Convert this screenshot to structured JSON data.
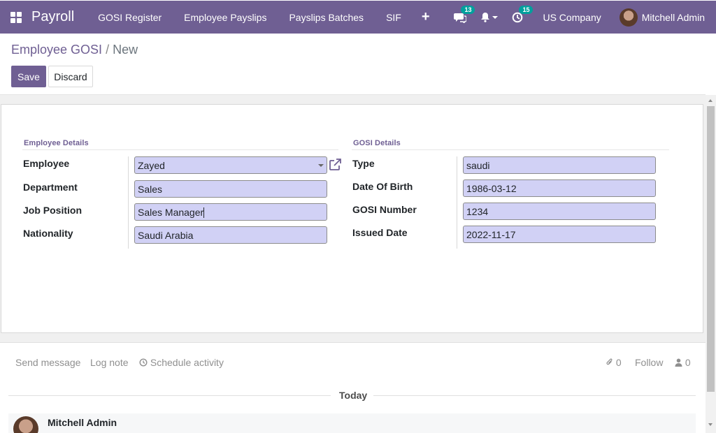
{
  "navbar": {
    "app_name": "Payroll",
    "menu": [
      "GOSI Register",
      "Employee Payslips",
      "Payslips Batches",
      "SIF"
    ],
    "plus": "+",
    "messages_badge": "13",
    "activities_badge": "15",
    "company": "US Company",
    "user": "Mitchell Admin"
  },
  "breadcrumb": {
    "parent": "Employee GOSI",
    "separator": " / ",
    "current": "New"
  },
  "buttons": {
    "save": "Save",
    "discard": "Discard"
  },
  "employee_details": {
    "title": "Employee Details",
    "fields": [
      {
        "label": "Employee",
        "value": "Zayed"
      },
      {
        "label": "Department",
        "value": "Sales"
      },
      {
        "label": "Job Position",
        "value": "Sales Manager"
      },
      {
        "label": "Nationality",
        "value": "Saudi Arabia"
      }
    ]
  },
  "gosi_details": {
    "title": "GOSI Details",
    "fields": [
      {
        "label": "Type",
        "value": "saudi"
      },
      {
        "label": "Date Of Birth",
        "value": "1986-03-12"
      },
      {
        "label": "GOSI Number",
        "value": "1234"
      },
      {
        "label": "Issued Date",
        "value": "2022-11-17"
      }
    ]
  },
  "chatter": {
    "send_message": "Send message",
    "log_note": "Log note",
    "schedule_activity": "Schedule activity",
    "attachments_count": "0",
    "follow": "Follow",
    "followers_count": "0",
    "today": "Today",
    "message_author": "Mitchell Admin"
  },
  "colors": {
    "primary": "#6f5f93",
    "field_bg": "#d1d1f5",
    "badge": "#00a09d"
  }
}
